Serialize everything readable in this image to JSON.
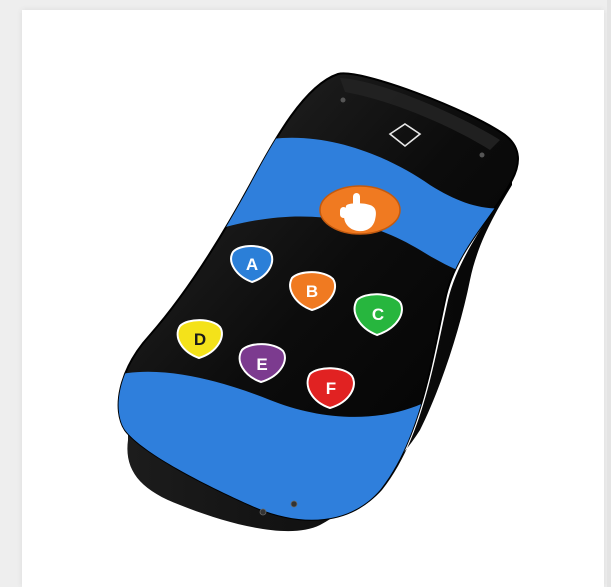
{
  "remote": {
    "body_color": "#111111",
    "band_color": "#2f7fdc",
    "hand_button": {
      "icon": "pointing-hand-icon",
      "color": "#f07a21"
    },
    "buttons": [
      {
        "label": "A",
        "color": "#2b7fd8"
      },
      {
        "label": "B",
        "color": "#f07a21"
      },
      {
        "label": "C",
        "color": "#27b63e"
      },
      {
        "label": "D",
        "color": "#f4e21a"
      },
      {
        "label": "E",
        "color": "#7c3b8f"
      },
      {
        "label": "F",
        "color": "#e12222"
      }
    ],
    "top_symbol": "diamond-icon"
  }
}
